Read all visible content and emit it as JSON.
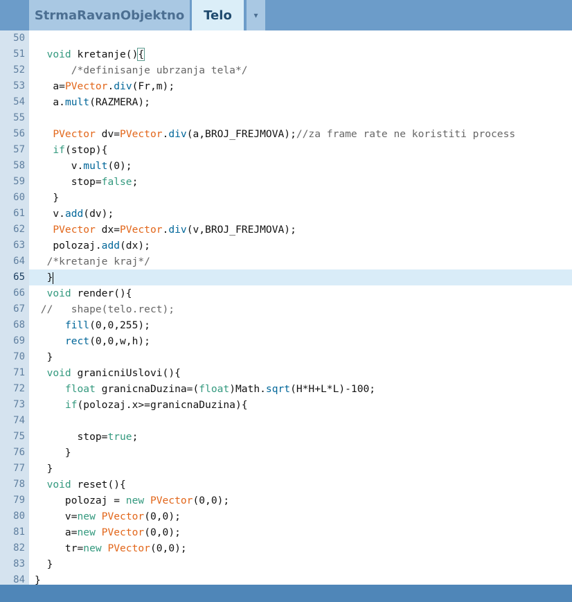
{
  "tabs": [
    {
      "label": "StrmaRavanObjektno",
      "active": false
    },
    {
      "label": "Telo",
      "active": true
    }
  ],
  "tab_menu_symbol": "▾",
  "current_line": 65,
  "lines": [
    {
      "num": "50",
      "text": ""
    },
    {
      "num": "51",
      "text": "  void kretanje(){"
    },
    {
      "num": "52",
      "text": "      /*definisanje ubrzanja tela*/"
    },
    {
      "num": "53",
      "text": "   a=PVector.div(Fr,m);"
    },
    {
      "num": "54",
      "text": "   a.mult(RAZMERA);"
    },
    {
      "num": "55",
      "text": ""
    },
    {
      "num": "56",
      "text": "   PVector dv=PVector.div(a,BROJ_FREJMOVA);//za frame rate ne koristiti process"
    },
    {
      "num": "57",
      "text": "   if(stop){"
    },
    {
      "num": "58",
      "text": "      v.mult(0);"
    },
    {
      "num": "59",
      "text": "      stop=false;"
    },
    {
      "num": "60",
      "text": "   }"
    },
    {
      "num": "61",
      "text": "   v.add(dv);"
    },
    {
      "num": "62",
      "text": "   PVector dx=PVector.div(v,BROJ_FREJMOVA);"
    },
    {
      "num": "63",
      "text": "   polozaj.add(dx);"
    },
    {
      "num": "64",
      "text": "  /*kretanje kraj*/"
    },
    {
      "num": "65",
      "text": "  }"
    },
    {
      "num": "66",
      "text": "  void render(){"
    },
    {
      "num": "67",
      "text": " //   shape(telo.rect);"
    },
    {
      "num": "68",
      "text": "     fill(0,0,255);"
    },
    {
      "num": "69",
      "text": "     rect(0,0,w,h);"
    },
    {
      "num": "70",
      "text": "  }"
    },
    {
      "num": "71",
      "text": "  void granicniUslovi(){"
    },
    {
      "num": "72",
      "text": "     float granicnaDuzina=(float)Math.sqrt(H*H+L*L)-100;"
    },
    {
      "num": "73",
      "text": "     if(polozaj.x>=granicnaDuzina){"
    },
    {
      "num": "74",
      "text": ""
    },
    {
      "num": "75",
      "text": "       stop=true;"
    },
    {
      "num": "76",
      "text": "     }"
    },
    {
      "num": "77",
      "text": "  }"
    },
    {
      "num": "78",
      "text": "  void reset(){"
    },
    {
      "num": "79",
      "text": "     polozaj = new PVector(0,0);"
    },
    {
      "num": "80",
      "text": "     v=new PVector(0,0);"
    },
    {
      "num": "81",
      "text": "     a=new PVector(0,0);"
    },
    {
      "num": "82",
      "text": "     tr=new PVector(0,0);"
    },
    {
      "num": "83",
      "text": "  }"
    },
    {
      "num": "84",
      "text": "}"
    }
  ]
}
